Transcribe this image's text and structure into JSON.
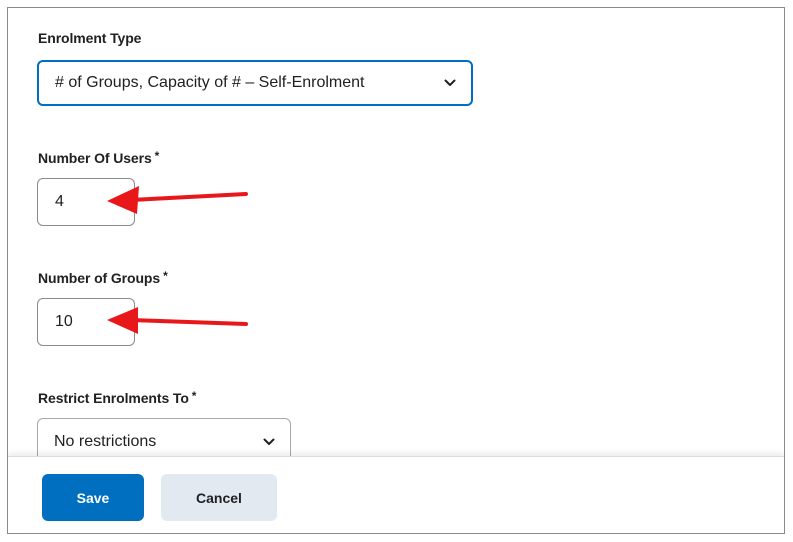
{
  "enrolment_type": {
    "label": "Enrolment Type",
    "selected_value": "# of Groups, Capacity of # – Self-Enrolment"
  },
  "number_of_users": {
    "label": "Number Of Users",
    "required_marker": "*",
    "value": "4"
  },
  "number_of_groups": {
    "label": "Number of Groups",
    "required_marker": "*",
    "value": "10"
  },
  "restrict_enrolments": {
    "label": "Restrict Enrolments To",
    "required_marker": "*",
    "selected_value": "No restrictions"
  },
  "footer": {
    "save_label": "Save",
    "cancel_label": "Cancel"
  },
  "colors": {
    "primary": "#006fbf",
    "secondary_button": "#e3e9f1",
    "annotation_arrow": "#e8171a"
  },
  "icons": {
    "dropdown": "chevron-down-icon",
    "annotation": "red-arrow-icon"
  }
}
